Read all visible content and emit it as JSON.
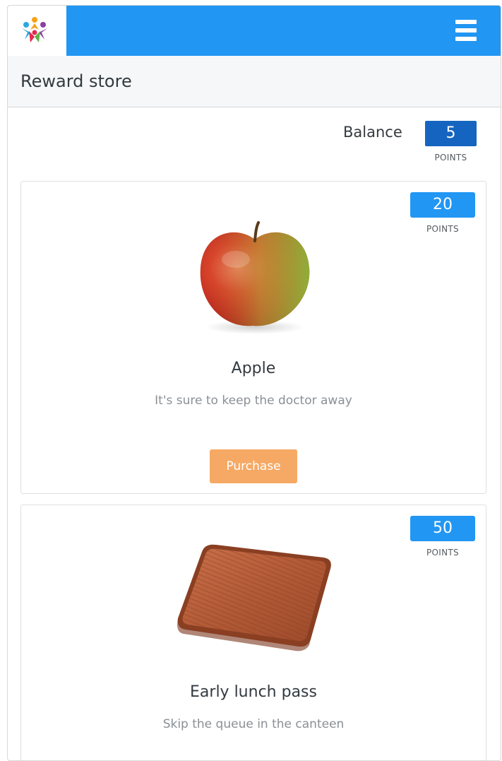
{
  "header": {
    "logo_icon": "people-logo-icon",
    "menu_icon": "hamburger-menu-icon",
    "brand_color": "#2196f3"
  },
  "page": {
    "title": "Reward store"
  },
  "balance": {
    "label": "Balance",
    "value": "5",
    "unit": "POINTS",
    "color": "#1565c0"
  },
  "rewards": [
    {
      "name": "Apple",
      "description": "It's sure to keep the doctor away",
      "points": "20",
      "unit": "POINTS",
      "image_icon": "apple-image",
      "button_label": "Purchase",
      "button_color": "#f6a964"
    },
    {
      "name": "Early lunch pass",
      "description": "Skip the queue in the canteen",
      "points": "50",
      "unit": "POINTS",
      "image_icon": "lunch-tray-image"
    }
  ]
}
